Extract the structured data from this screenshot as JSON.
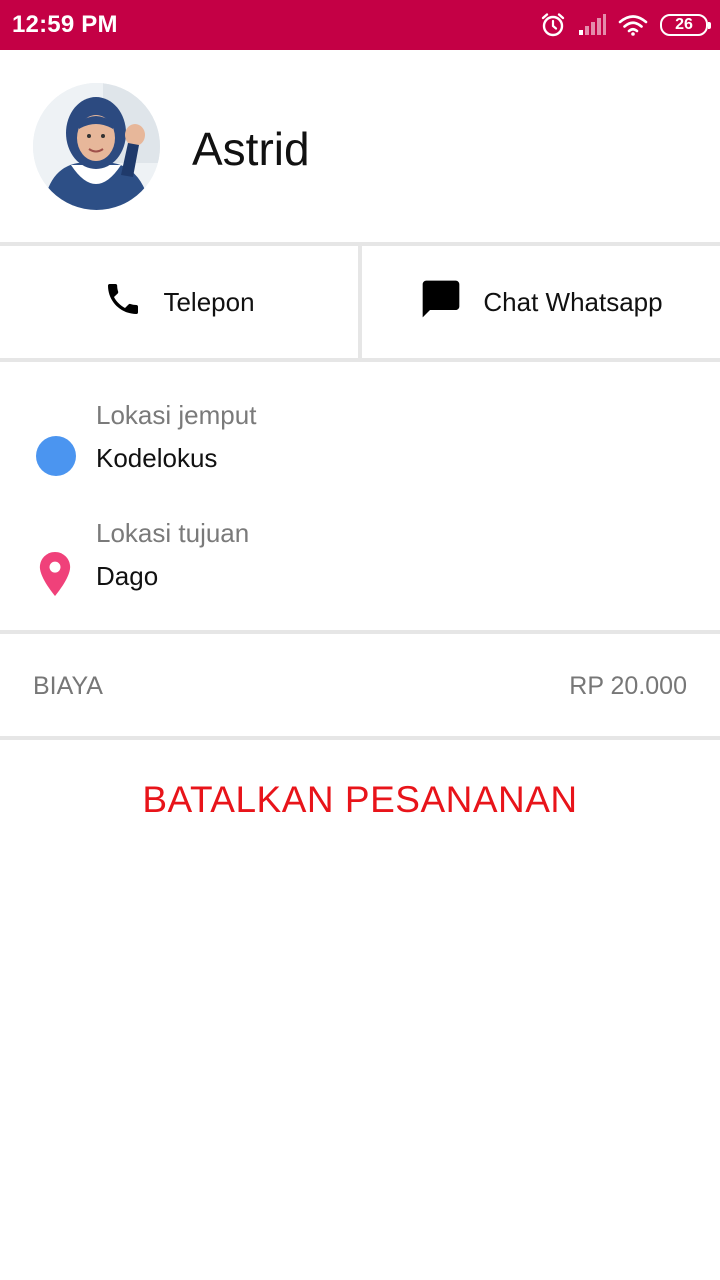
{
  "status_bar": {
    "time": "12:59 PM",
    "battery": "26",
    "background_color": "#c40045"
  },
  "driver": {
    "name": "Astrid"
  },
  "actions": {
    "call_label": "Telepon",
    "chat_label": "Chat Whatsapp"
  },
  "pickup": {
    "label": "Lokasi jemput",
    "value": "Kodelokus",
    "icon_color": "#4b95f0"
  },
  "destination": {
    "label": "Lokasi tujuan",
    "value": "Dago",
    "icon_color": "#f0417a"
  },
  "fee": {
    "label": "BIAYA",
    "value": "RP 20.000"
  },
  "cancel": {
    "label": "BATALKAN PESANANAN",
    "color": "#e8141a"
  }
}
